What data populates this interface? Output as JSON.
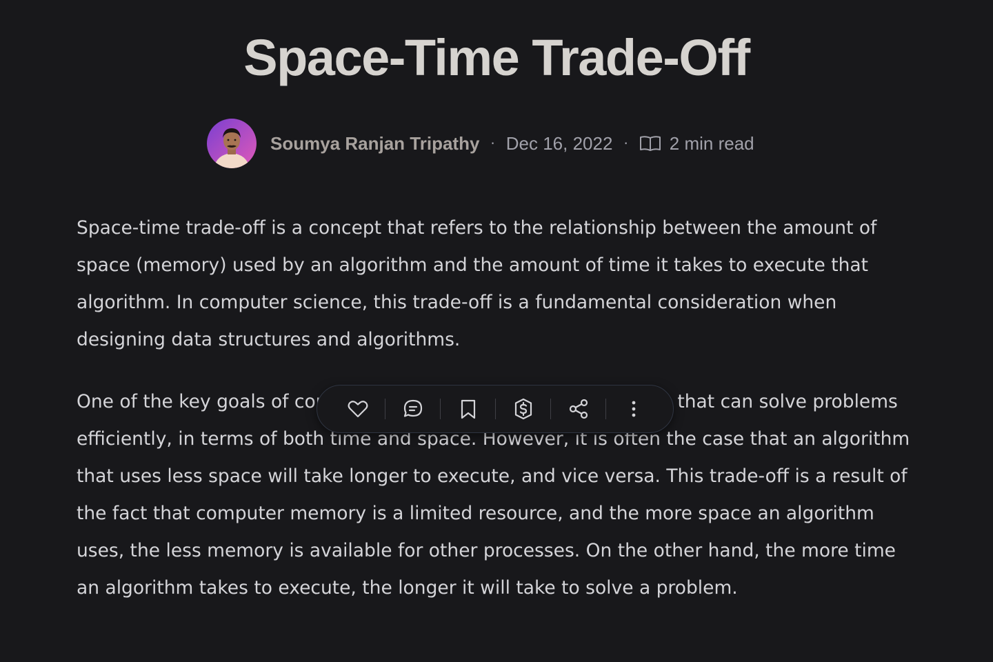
{
  "article": {
    "title": "Space-Time Trade-Off",
    "author": "Soumya Ranjan Tripathy",
    "separator": "·",
    "date": "Dec 16, 2022",
    "read_time": "2 min read",
    "paragraphs": [
      "Space-time trade-off is a concept that refers to the relationship between the amount of space (memory) used by an algorithm and the amount of time it takes to execute that algorithm. In computer science, this trade-off is a fundamental consideration when designing data structures and algorithms.",
      "One of the key goals of computer science is to design algorithms that can solve problems efficiently, in terms of both time and space. However, it is often the case that an algorithm that uses less space will take longer to execute, and vice versa. This trade-off is a result of the fact that computer memory is a limited resource, and the more space an algorithm uses, the less memory is available for other processes. On the other hand, the more time an algorithm takes to execute, the longer it will take to solve a problem."
    ]
  },
  "toolbar": {
    "icons": [
      "heart-icon",
      "comment-icon",
      "bookmark-icon",
      "dollar-icon",
      "share-icon",
      "more-icon"
    ]
  },
  "colors": {
    "background": "#18181b",
    "title": "#d6d3cf",
    "text": "#d4d4d8",
    "muted": "#a1a1aa",
    "avatar_ring": "#c04fd0"
  }
}
